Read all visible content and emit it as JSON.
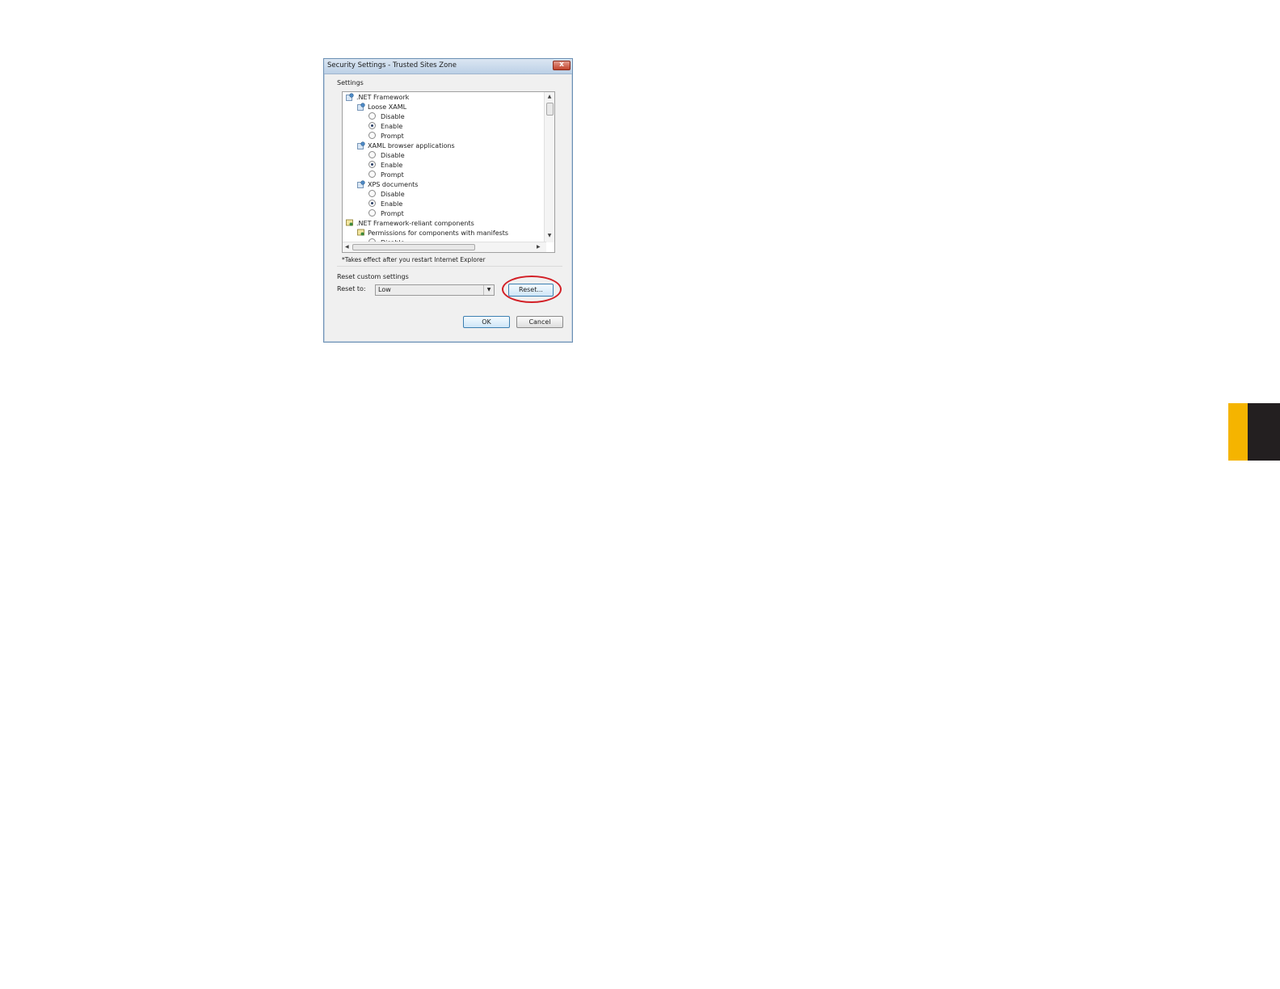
{
  "dialog": {
    "title": "Security Settings - Trusted Sites Zone",
    "close_glyph": "x",
    "settings_label": "Settings",
    "tree": [
      {
        "type": "category",
        "icon": "dotnet-gear-icon",
        "label": ".NET Framework",
        "indent": 0
      },
      {
        "type": "category",
        "icon": "dotnet-gear-icon",
        "label": "Loose XAML",
        "indent": 1
      },
      {
        "type": "option",
        "label": "Disable",
        "checked": false
      },
      {
        "type": "option",
        "label": "Enable",
        "checked": true
      },
      {
        "type": "option",
        "label": "Prompt",
        "checked": false
      },
      {
        "type": "category",
        "icon": "dotnet-gear-icon",
        "label": "XAML browser applications",
        "indent": 1
      },
      {
        "type": "option",
        "label": "Disable",
        "checked": false
      },
      {
        "type": "option",
        "label": "Enable",
        "checked": true
      },
      {
        "type": "option",
        "label": "Prompt",
        "checked": false
      },
      {
        "type": "category",
        "icon": "dotnet-gear-icon",
        "label": "XPS documents",
        "indent": 1
      },
      {
        "type": "option",
        "label": "Disable",
        "checked": false
      },
      {
        "type": "option",
        "label": "Enable",
        "checked": true
      },
      {
        "type": "option",
        "label": "Prompt",
        "checked": false
      },
      {
        "type": "category",
        "icon": "certificate-icon",
        "label": ".NET Framework-reliant components",
        "indent": 0
      },
      {
        "type": "category",
        "icon": "certificate-icon",
        "label": "Permissions for components with manifests",
        "indent": 1
      },
      {
        "type": "option",
        "label": "Disable",
        "checked": false
      }
    ],
    "note": "*Takes effect after you restart Internet Explorer",
    "reset_section_label": "Reset custom settings",
    "reset_to_label": "Reset to:",
    "reset_to_value": "Low",
    "reset_button": "Reset...",
    "ok_button": "OK",
    "cancel_button": "Cancel",
    "colors": {
      "highlight_ring": "#d21f26",
      "edge_tab_gold": "#f5b400",
      "edge_tab_dark": "#231f20"
    }
  }
}
